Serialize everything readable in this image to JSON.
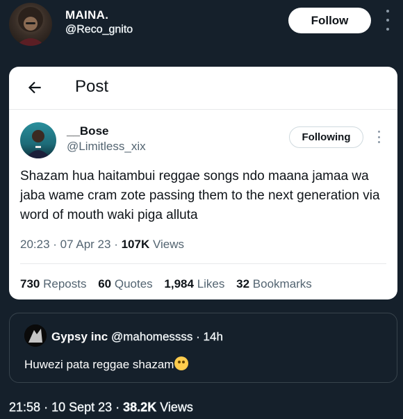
{
  "author": {
    "name": "MAINA.",
    "handle": "@Reco_gnito",
    "follow_label": "Follow"
  },
  "embedded_post": {
    "header_title": "Post",
    "user": {
      "name": "__Bose",
      "handle": "@Limitless_xix",
      "following_label": "Following"
    },
    "text": "Shazam hua haitambui reggae songs ndo maana jamaa wa jaba wame cram zote passing them to the next generation via word of mouth waki piga alluta",
    "time": "20:23",
    "date": "07 Apr 23",
    "views_count": "107K",
    "views_label": "Views",
    "stats": {
      "reposts_count": "730",
      "reposts_label": "Reposts",
      "quotes_count": "60",
      "quotes_label": "Quotes",
      "likes_count": "1,984",
      "likes_label": "Likes",
      "bookmarks_count": "32",
      "bookmarks_label": "Bookmarks"
    }
  },
  "reply": {
    "name": "Gypsy inc",
    "handle": "@mahomessss",
    "time": "14h",
    "text": "Huwezi pata reggae shazam",
    "emoji_icon": "rolling-on-floor-laughing-emoji"
  },
  "footer": {
    "time": "21:58",
    "date": "10 Sept 23",
    "views_count": "38.2K",
    "views_label": "Views"
  },
  "colors": {
    "background": "#15202b",
    "card": "#ffffff",
    "secondary_text": "#536471"
  }
}
